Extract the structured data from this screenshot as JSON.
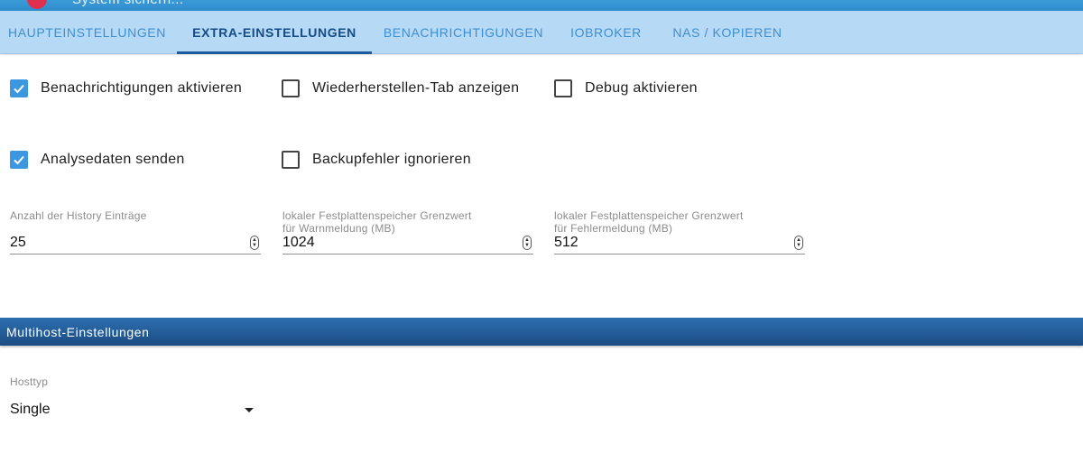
{
  "header": {
    "subtitle": "System sichern..."
  },
  "tabs": [
    {
      "label": "HAUPTEINSTELLUNGEN",
      "active": false
    },
    {
      "label": "EXTRA-EINSTELLUNGEN",
      "active": true
    },
    {
      "label": "BENACHRICHTIGUNGEN",
      "active": false
    },
    {
      "label": "IOBROKER",
      "active": false
    },
    {
      "label": "NAS / KOPIEREN",
      "active": false
    }
  ],
  "checkboxes": [
    {
      "label": "Benachrichtigungen aktivieren",
      "checked": true
    },
    {
      "label": "Wiederherstellen-Tab anzeigen",
      "checked": false
    },
    {
      "label": "Debug aktivieren",
      "checked": false
    },
    {
      "label": "Analysedaten senden",
      "checked": true
    },
    {
      "label": "Backupfehler ignorieren",
      "checked": false
    }
  ],
  "fields": [
    {
      "label_line1": "Anzahl der History Einträge",
      "label_line2": "",
      "value": "25"
    },
    {
      "label_line1": "lokaler Festplattenspeicher Grenzwert",
      "label_line2": "für Warnmeldung (MB)",
      "value": "1024"
    },
    {
      "label_line1": "lokaler Festplattenspeicher Grenzwert",
      "label_line2": "für Fehlermeldung (MB)",
      "value": "512"
    }
  ],
  "multihost": {
    "section_title": "Multihost-Einstellungen",
    "hosttype_label": "Hosttyp",
    "hosttype_value": "Single"
  },
  "colors": {
    "tab_bar": "#b6d9f6",
    "tab_active": "#164c86",
    "tab_inactive": "#3f8fd0",
    "checkbox_checked": "#3b97e0",
    "section_header": "#1b4c83"
  },
  "icons": {
    "check": "check-icon",
    "spinner": "spinner-icon",
    "dropdown": "chevron-down-icon"
  }
}
